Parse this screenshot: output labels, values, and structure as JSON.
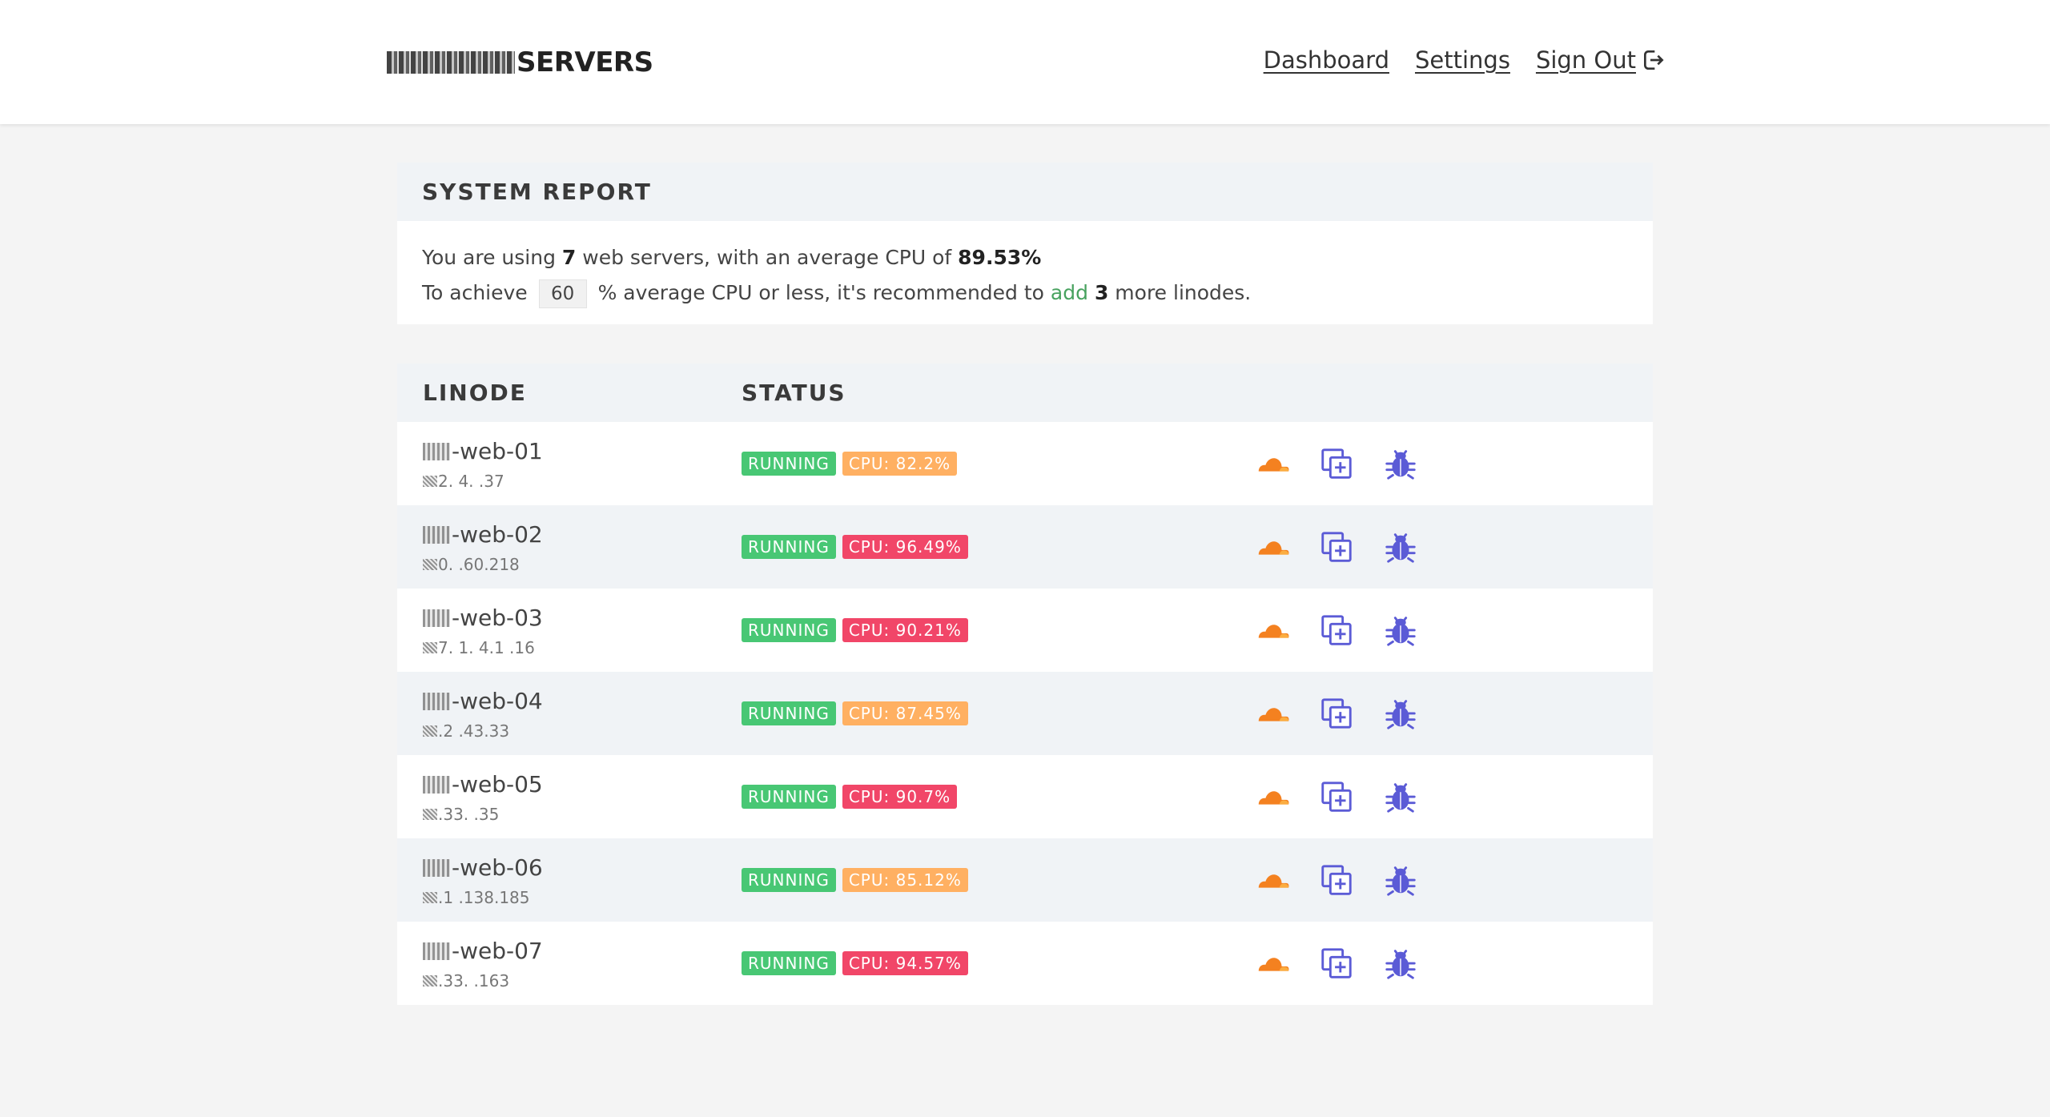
{
  "header": {
    "brand_suffix": "SERVERS",
    "nav": {
      "dashboard": "Dashboard",
      "settings": "Settings",
      "sign_out": "Sign Out"
    }
  },
  "report": {
    "title": "SYSTEM REPORT",
    "line1_prefix": "You are using ",
    "server_count": "7",
    "line1_middle": " web servers, with an average CPU of ",
    "avg_cpu": "89.53%",
    "line2_prefix": "To achieve ",
    "target_cpu": "60",
    "line2_middle": " % average CPU or less, it's recommended to ",
    "add_link": "add",
    "add_count": "3",
    "line2_suffix": " more linodes."
  },
  "table": {
    "headers": {
      "linode": "LINODE",
      "status": "STATUS"
    },
    "rows": [
      {
        "name": "-web-01",
        "ip": "2. 4. .37",
        "status": "RUNNING",
        "cpu": "CPU: 82.2%",
        "cpu_level": "warn"
      },
      {
        "name": "-web-02",
        "ip": "0. .60.218",
        "status": "RUNNING",
        "cpu": "CPU: 96.49%",
        "cpu_level": "danger"
      },
      {
        "name": "-web-03",
        "ip": "7. 1. 4.1 .16",
        "status": "RUNNING",
        "cpu": "CPU: 90.21%",
        "cpu_level": "danger"
      },
      {
        "name": "-web-04",
        "ip": ".2 .43.33",
        "status": "RUNNING",
        "cpu": "CPU: 87.45%",
        "cpu_level": "warn"
      },
      {
        "name": "-web-05",
        "ip": ".33. .35",
        "status": "RUNNING",
        "cpu": "CPU: 90.7%",
        "cpu_level": "danger"
      },
      {
        "name": "-web-06",
        "ip": ".1 .138.185",
        "status": "RUNNING",
        "cpu": "CPU: 85.12%",
        "cpu_level": "warn"
      },
      {
        "name": "-web-07",
        "ip": ".33. .163",
        "status": "RUNNING",
        "cpu": "CPU: 94.57%",
        "cpu_level": "danger"
      }
    ]
  },
  "icons": {
    "cloudflare": "cloudflare-icon",
    "clone": "clone-icon",
    "debug": "bug-icon",
    "sign_out": "sign-out-icon"
  },
  "colors": {
    "running": "#48c774",
    "cpu_warn": "#ffb062",
    "cpu_danger": "#f14668",
    "cloud": "#f48120",
    "action_icon": "#5b5bd6",
    "add_link": "#48a25f"
  }
}
